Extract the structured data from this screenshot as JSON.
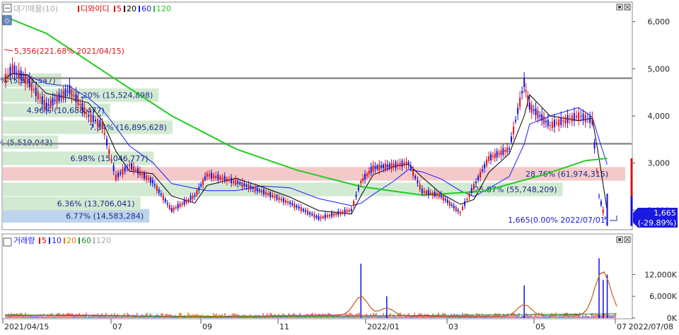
{
  "price_panel": {
    "legend_items": [
      {
        "text": "대기매물(10)",
        "color": "#aaaaaa"
      },
      {
        "text": "디와이디",
        "color": "#e00000"
      },
      {
        "text": "5",
        "color": "#e00000"
      },
      {
        "text": "20",
        "color": "#000000"
      },
      {
        "text": "60",
        "color": "#1a1aff"
      },
      {
        "text": "120",
        "color": "#22cc22"
      }
    ],
    "high_annotation": "5,356(221.68% 2021/04/15)",
    "last_annotation": "1,665(0.00% 2022/07/01)",
    "current_price_tag": "1,665",
    "current_change_tag": "(-29.89%)",
    "y_ticks": [
      "6,000",
      "5,000",
      "4,000",
      "3,000",
      "2,000"
    ],
    "y_tick_values": [
      6000,
      5000,
      4000,
      3000,
      2000
    ],
    "y_range": [
      1600,
      6400
    ],
    "hlines": [
      4800,
      3410
    ],
    "volume_profile": [
      {
        "label": "6.77% (14,583,284)",
        "price": 1880,
        "pct": 6.77,
        "color": "#bcd4ec"
      },
      {
        "label": "6.36% (13,706,041)",
        "price": 2140,
        "pct": 6.36,
        "color": "#d3ead2"
      },
      {
        "label": "25.87% (55,748,209)",
        "price": 2440,
        "pct": 25.87,
        "color": "#d3ead2"
      },
      {
        "label": "28.76% (61,974,315)",
        "price": 2770,
        "pct": 28.76,
        "color": "#f4c9c9"
      },
      {
        "label": "6.98% (15,046,777)",
        "price": 3100,
        "pct": 6.98,
        "color": "#d3ead2"
      },
      {
        "label": "2.56% (5,519,043)",
        "price": 3440,
        "pct": 2.56,
        "color": "#d3ead2"
      },
      {
        "label": "7.84% (16,895,628)",
        "price": 3760,
        "pct": 7.84,
        "color": "#d3ead2"
      },
      {
        "label": "4.96% (10,688,477)",
        "price": 4120,
        "pct": 4.96,
        "color": "#d3ead2"
      },
      {
        "label": "7.20% (15,524,898)",
        "price": 4440,
        "pct": 7.2,
        "color": "#d3ead2"
      },
      {
        "label": "2.70% (5,811,547)",
        "price": 4760,
        "pct": 2.7,
        "color": "#d3ead2"
      }
    ]
  },
  "volume_panel": {
    "legend_items": [
      {
        "text": "거래량",
        "color": "#1a1aff"
      },
      {
        "text": "5",
        "color": "#e00000"
      },
      {
        "text": "10",
        "color": "#1a1aff"
      },
      {
        "text": "20",
        "color": "#e08000"
      },
      {
        "text": "60",
        "color": "#228822"
      },
      {
        "text": "120",
        "color": "#aaaaaa"
      }
    ],
    "y_ticks": [
      "12,000K",
      "6,000K",
      "0K"
    ],
    "y_tick_values": [
      12000,
      6000,
      0
    ],
    "y_max": 19500
  },
  "x_axis": {
    "labels": [
      "2021/04/15",
      "07",
      "09",
      "11",
      "2022/01",
      "03",
      "05",
      "07",
      "2022/07/08"
    ]
  },
  "chart_data": {
    "type": "candlestick",
    "title": "",
    "x_range": [
      "2021/04/15",
      "2022/07/08"
    ],
    "price_series": [
      {
        "date": "2021/04/15",
        "close": 4800
      },
      {
        "date": "2021/04/20",
        "close": 5000
      },
      {
        "date": "2021/05/01",
        "close": 4750
      },
      {
        "date": "2021/05/15",
        "close": 4200
      },
      {
        "date": "2021/06/01",
        "close": 4550
      },
      {
        "date": "2021/06/15",
        "close": 4000
      },
      {
        "date": "2021/06/25",
        "close": 3800
      },
      {
        "date": "2021/07/05",
        "close": 2700
      },
      {
        "date": "2021/07/15",
        "close": 2950
      },
      {
        "date": "2021/08/01",
        "close": 2600
      },
      {
        "date": "2021/08/15",
        "close": 2000
      },
      {
        "date": "2021/09/01",
        "close": 2300
      },
      {
        "date": "2021/09/10",
        "close": 2750
      },
      {
        "date": "2021/10/01",
        "close": 2600
      },
      {
        "date": "2021/10/20",
        "close": 2400
      },
      {
        "date": "2021/11/10",
        "close": 2150
      },
      {
        "date": "2021/12/01",
        "close": 1830
      },
      {
        "date": "2021/12/25",
        "close": 2000
      },
      {
        "date": "2022/01/01",
        "close": 2600
      },
      {
        "date": "2022/01/10",
        "close": 2900
      },
      {
        "date": "2022/01/25",
        "close": 2950
      },
      {
        "date": "2022/02/05",
        "close": 3000
      },
      {
        "date": "2022/02/15",
        "close": 2400
      },
      {
        "date": "2022/03/01",
        "close": 2300
      },
      {
        "date": "2022/03/15",
        "close": 1950
      },
      {
        "date": "2022/03/25",
        "close": 2500
      },
      {
        "date": "2022/04/05",
        "close": 3100
      },
      {
        "date": "2022/04/20",
        "close": 3300
      },
      {
        "date": "2022/05/01",
        "close": 4700
      },
      {
        "date": "2022/05/05",
        "close": 4200
      },
      {
        "date": "2022/05/20",
        "close": 3800
      },
      {
        "date": "2022/06/10",
        "close": 4000
      },
      {
        "date": "2022/06/20",
        "close": 3900
      },
      {
        "date": "2022/06/25",
        "close": 2300
      },
      {
        "date": "2022/07/01",
        "close": 1665
      }
    ],
    "ma120": [
      {
        "date": "2021/04/15",
        "value": 6100
      },
      {
        "date": "2021/05/15",
        "value": 5750
      },
      {
        "date": "2021/07/01",
        "value": 4850
      },
      {
        "date": "2021/08/15",
        "value": 4000
      },
      {
        "date": "2021/10/01",
        "value": 3300
      },
      {
        "date": "2021/11/15",
        "value": 2850
      },
      {
        "date": "2022/01/01",
        "value": 2500
      },
      {
        "date": "2022/02/15",
        "value": 2320
      },
      {
        "date": "2022/04/01",
        "value": 2400
      },
      {
        "date": "2022/05/15",
        "value": 2750
      },
      {
        "date": "2022/06/15",
        "value": 3050
      },
      {
        "date": "2022/07/01",
        "value": 3100
      }
    ],
    "volume_spikes": [
      {
        "date": "2022/01/01",
        "value": 15000
      },
      {
        "date": "2022/01/20",
        "value": 6000
      },
      {
        "date": "2022/05/01",
        "value": 9000
      },
      {
        "date": "2022/06/25",
        "value": 16500
      },
      {
        "date": "2022/06/28",
        "value": 10500
      },
      {
        "date": "2022/07/01",
        "value": 12000
      }
    ]
  }
}
